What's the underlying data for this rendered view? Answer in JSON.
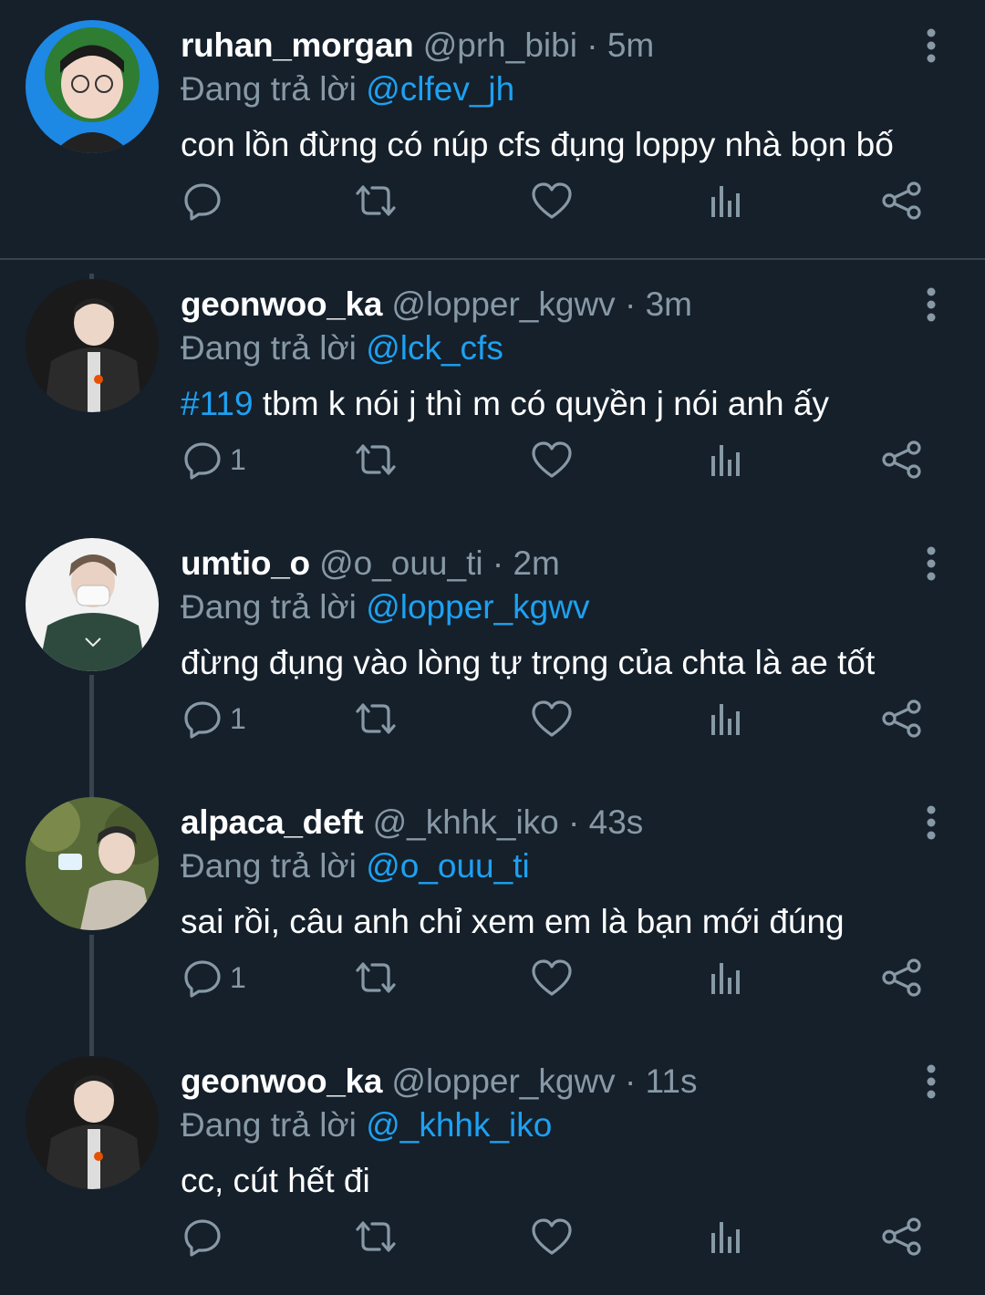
{
  "colors": {
    "background": "#15202b",
    "muted": "#8899a6",
    "accent": "#1da1f2",
    "divider": "#38444d"
  },
  "icons": {
    "more": "more-vertical-icon",
    "reply": "reply-icon",
    "retweet": "retweet-icon",
    "like": "heart-icon",
    "views": "analytics-icon",
    "share": "share-icon"
  },
  "tweets": [
    {
      "name": "ruhan_morgan",
      "handle": "@prh_bibi",
      "separator": "·",
      "time": "5m",
      "reply_prefix": "Đang trả lời",
      "reply_to": "@clfev_jh",
      "hashtag": "",
      "text": "con lồn đừng có núp cfs đụng loppy nhà bọn bố",
      "reply_count": ""
    },
    {
      "name": "geonwoo_ka",
      "handle": "@lopper_kgwv",
      "separator": "·",
      "time": "3m",
      "reply_prefix": "Đang trả lời",
      "reply_to": "@lck_cfs",
      "hashtag": "#119",
      "text": " tbm k nói j thì m có quyền j nói anh ấy",
      "reply_count": "1"
    },
    {
      "name": "umtio_o",
      "handle": "@o_ouu_ti",
      "separator": "·",
      "time": "2m",
      "reply_prefix": "Đang trả lời",
      "reply_to": "@lopper_kgwv",
      "hashtag": "",
      "text": "đừng đụng vào lòng tự trọng của chta là ae tốt",
      "reply_count": "1"
    },
    {
      "name": "alpaca_deft",
      "handle": "@_khhk_iko",
      "separator": "·",
      "time": "43s",
      "reply_prefix": "Đang trả lời",
      "reply_to": "@o_ouu_ti",
      "hashtag": "",
      "text": "sai rồi, câu anh chỉ xem em là bạn mới đúng",
      "reply_count": "1"
    },
    {
      "name": "geonwoo_ka",
      "handle": "@lopper_kgwv",
      "separator": "·",
      "time": "11s",
      "reply_prefix": "Đang trả lời",
      "reply_to": "@_khhk_iko",
      "hashtag": "",
      "text": "cc, cút hết đi",
      "reply_count": ""
    }
  ]
}
